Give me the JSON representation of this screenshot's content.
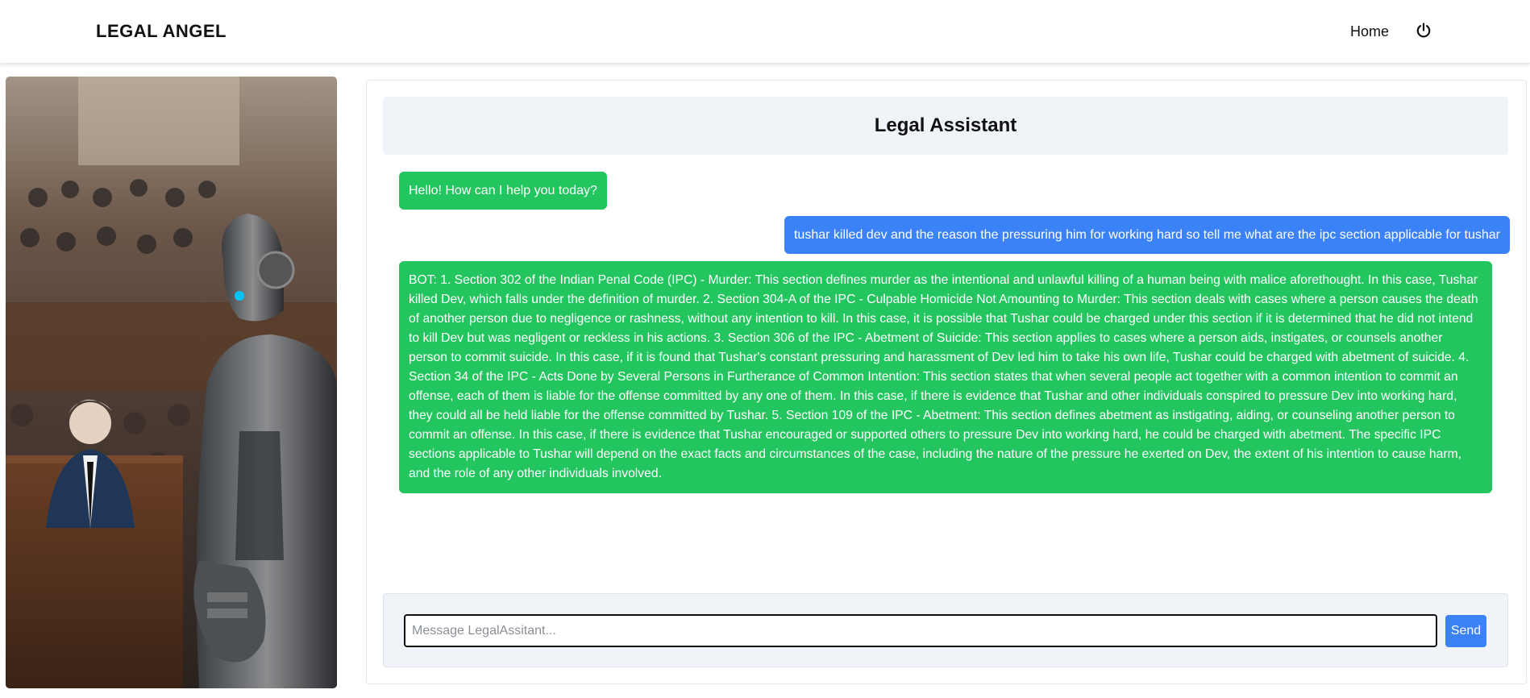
{
  "nav": {
    "brand": "LEGAL ANGEL",
    "home_label": "Home",
    "power_icon": "power-icon"
  },
  "hero": {
    "image_icon": "courtroom-robot-illustration"
  },
  "chat": {
    "title": "Legal Assistant",
    "messages": [
      {
        "role": "bot",
        "text": "Hello! How can I help you today?"
      },
      {
        "role": "user",
        "text": "tushar killed dev and the reason the pressuring him for working hard so tell me what are the ipc section applicable for tushar"
      },
      {
        "role": "bot",
        "text": "BOT: 1. Section 302 of the Indian Penal Code (IPC) - Murder: This section defines murder as the intentional and unlawful killing of a human being with malice aforethought. In this case, Tushar killed Dev, which falls under the definition of murder. 2. Section 304-A of the IPC - Culpable Homicide Not Amounting to Murder: This section deals with cases where a person causes the death of another person due to negligence or rashness, without any intention to kill. In this case, it is possible that Tushar could be charged under this section if it is determined that he did not intend to kill Dev but was negligent or reckless in his actions. 3. Section 306 of the IPC - Abetment of Suicide: This section applies to cases where a person aids, instigates, or counsels another person to commit suicide. In this case, if it is found that Tushar's constant pressuring and harassment of Dev led him to take his own life, Tushar could be charged with abetment of suicide. 4. Section 34 of the IPC - Acts Done by Several Persons in Furtherance of Common Intention: This section states that when several people act together with a common intention to commit an offense, each of them is liable for the offense committed by any one of them. In this case, if there is evidence that Tushar and other individuals conspired to pressure Dev into working hard, they could all be held liable for the offense committed by Tushar. 5. Section 109 of the IPC - Abetment: This section defines abetment as instigating, aiding, or counseling another person to commit an offense. In this case, if there is evidence that Tushar encouraged or supported others to pressure Dev into working hard, he could be charged with abetment. The specific IPC sections applicable to Tushar will depend on the exact facts and circumstances of the case, including the nature of the pressure he exerted on Dev, the extent of his intention to cause harm, and the role of any other individuals involved."
      }
    ],
    "input": {
      "value": "",
      "placeholder": "Message LegalAssitant..."
    },
    "send_label": "Send"
  },
  "colors": {
    "bot_bubble": "#22c55e",
    "user_bubble": "#3b82f6",
    "title_bg": "#f0f3f7",
    "send_button": "#3b82f6"
  }
}
